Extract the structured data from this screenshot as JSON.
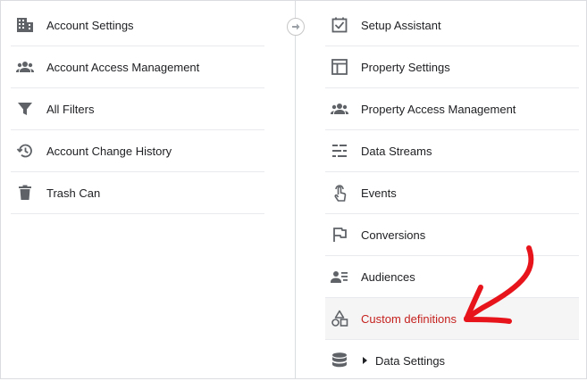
{
  "account": {
    "items": [
      {
        "label": "Account Settings",
        "icon": "building-icon"
      },
      {
        "label": "Account Access Management",
        "icon": "people-icon"
      },
      {
        "label": "All Filters",
        "icon": "filter-icon"
      },
      {
        "label": "Account Change History",
        "icon": "history-icon"
      },
      {
        "label": "Trash Can",
        "icon": "trash-icon"
      }
    ]
  },
  "property": {
    "items": [
      {
        "label": "Setup Assistant",
        "icon": "checkbox-icon"
      },
      {
        "label": "Property Settings",
        "icon": "layout-icon"
      },
      {
        "label": "Property Access Management",
        "icon": "people-icon"
      },
      {
        "label": "Data Streams",
        "icon": "streams-icon"
      },
      {
        "label": "Events",
        "icon": "touch-icon"
      },
      {
        "label": "Conversions",
        "icon": "flag-icon"
      },
      {
        "label": "Audiences",
        "icon": "audience-icon"
      },
      {
        "label": "Custom definitions",
        "icon": "shapes-icon",
        "active": true
      },
      {
        "label": "Data Settings",
        "icon": "database-icon",
        "expandable": true
      }
    ]
  },
  "colors": {
    "active_text": "#c5221f",
    "annotation_arrow": "#e8141c",
    "icon": "#5f6368"
  }
}
